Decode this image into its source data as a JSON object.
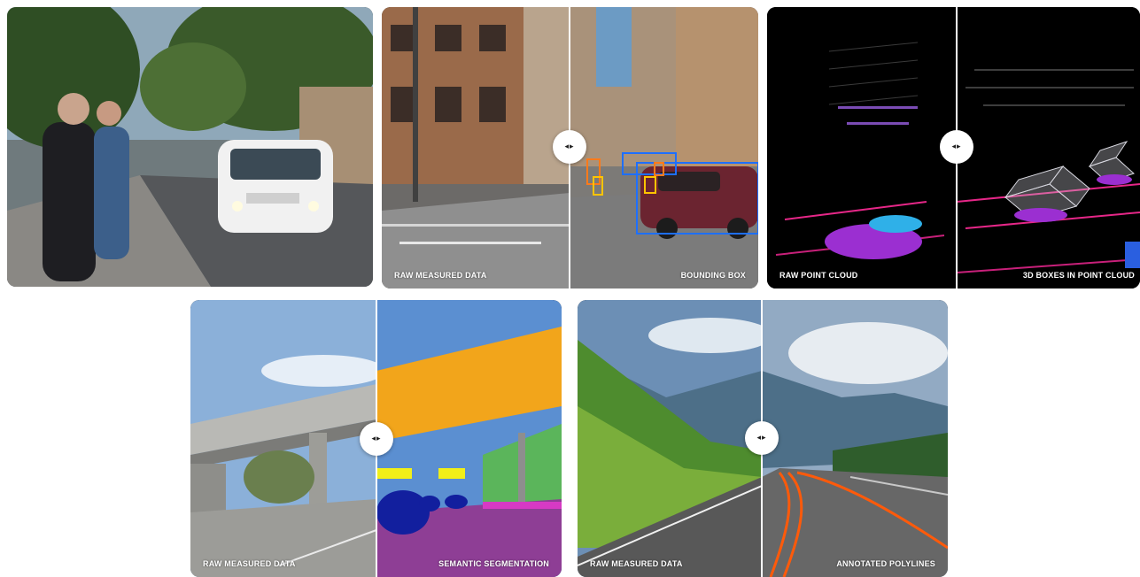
{
  "gallery": {
    "cards": [
      {
        "id": "street-photo"
      },
      {
        "id": "bounding-box",
        "left_label": "RAW MEASURED DATA",
        "right_label": "BOUNDING BOX"
      },
      {
        "id": "point-cloud",
        "left_label": "RAW POINT CLOUD",
        "right_label": "3D BOXES IN POINT CLOUD"
      },
      {
        "id": "semantic-segmentation",
        "left_label": "RAW MEASURED DATA",
        "right_label": "SEMANTIC SEGMENTATION"
      },
      {
        "id": "polylines",
        "left_label": "RAW MEASURED DATA",
        "right_label": "ANNOTATED POLYLINES"
      }
    ],
    "handle_icon": "left-right-arrows-icon",
    "handle_glyph": "◂▸",
    "colors": {
      "bbox_orange": "#ff7a1a",
      "bbox_yellow": "#ffc400",
      "bbox_blue": "#1e6fff",
      "seg_sky": "#5b8fd1",
      "seg_overpass": "#f2a51b",
      "seg_vegetation": "#5bb55b",
      "seg_road": "#8e3e95",
      "seg_car": "#121f9e",
      "seg_sign": "#f1ef19",
      "polyline_orange": "#ff5a0a"
    }
  }
}
